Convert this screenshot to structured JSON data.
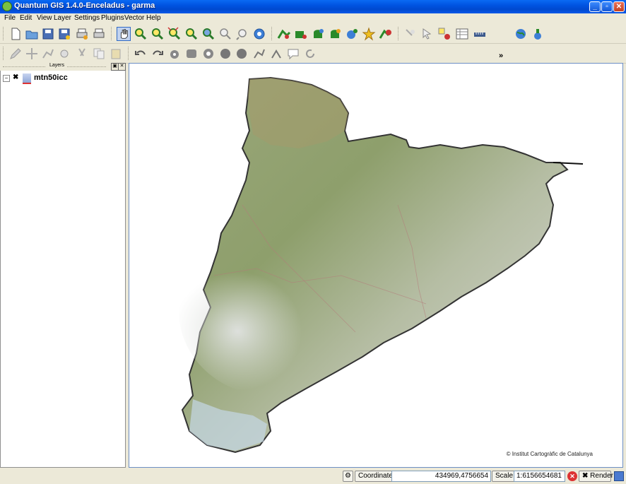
{
  "window": {
    "title": "Quantum GIS 1.4.0-Enceladus - garma"
  },
  "menu": [
    "File",
    "Edit",
    "View",
    "Layer",
    "Settings",
    "Plugins",
    "Vector",
    "Help"
  ],
  "toolbar1": [
    "new-project-icon",
    "open-project-icon",
    "save-project-icon",
    "save-as-icon",
    "print-composer-icon",
    "print-icon",
    "pan-icon",
    "zoom-in-icon",
    "zoom-out-icon",
    "zoom-full-icon",
    "zoom-selection-icon",
    "zoom-layer-icon",
    "zoom-last-icon",
    "zoom-next-icon",
    "refresh-icon",
    "add-vector-layer-icon",
    "add-raster-layer-icon",
    "add-postgis-layer-icon",
    "add-spatialite-layer-icon",
    "add-wms-layer-icon",
    "new-vector-layer-icon",
    "remove-layer-icon",
    "identify-icon",
    "select-icon",
    "deselect-icon",
    "attribute-table-icon",
    "measure-icon",
    "more-icon",
    "georeferencer-icon",
    "python-icon"
  ],
  "toolbar2": [
    "toggle-editing-icon",
    "move-feature-icon",
    "node-tool-icon",
    "delete-selected-icon",
    "cut-features-icon",
    "copy-features-icon",
    "paste-features-icon",
    "undo-icon",
    "redo-icon",
    "add-ring-icon",
    "add-part-icon",
    "delete-ring-icon",
    "delete-part-icon",
    "reshape-icon",
    "split-icon",
    "merge-icon",
    "annotation-icon",
    "rotate-icon"
  ],
  "layers_panel": {
    "title": "Layers",
    "layer_name": "mtn50icc",
    "layer_checked": true
  },
  "map": {
    "copyright": "© Institut Cartogràfic de Catalunya"
  },
  "status": {
    "coordinate_label": "Coordinate:",
    "coordinate_value": "434969,4756654",
    "scale_label": "Scale",
    "scale_value": "1:6156654681",
    "render_label": "Render",
    "render_checked": true
  },
  "colors": {
    "title_bar": "#0053e1",
    "map_green": "#8ea36a",
    "map_light": "#d9ddd8"
  }
}
